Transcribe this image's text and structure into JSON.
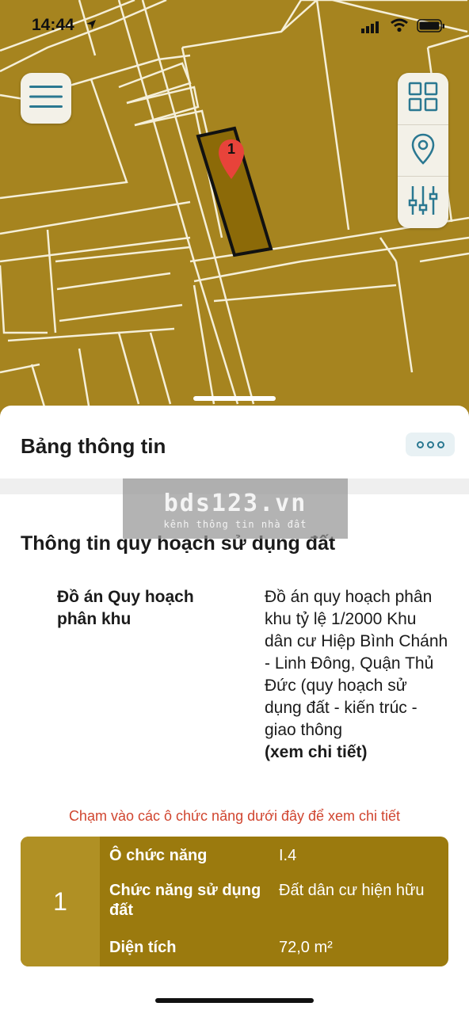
{
  "status_bar": {
    "time": "14:44"
  },
  "map": {
    "fill_color": "#a6841f",
    "line_color": "#f5efd8",
    "marker_label": "1",
    "marker_color": "#e8433a"
  },
  "toolbar": {
    "menu_icon": "hamburger-icon",
    "tools": [
      {
        "icon": "grid-icon"
      },
      {
        "icon": "location-pin-icon"
      },
      {
        "icon": "sliders-icon"
      }
    ]
  },
  "sheet": {
    "title": "Bảng thông tin",
    "more_icon": "more-dots-icon"
  },
  "watermark": {
    "main": "bds123.vn",
    "sub": "kênh thông tin nhà đất"
  },
  "planning": {
    "section_title": "Thông tin quy hoạch sử dụng đất",
    "label": "Đồ án Quy hoạch phân khu",
    "value": "Đồ án quy hoạch phân khu tỷ lệ 1/2000 Khu dân cư Hiệp Bình Chánh - Linh Đông, Quận Thủ Đức (quy hoạch sử dụng đất - kiến trúc - giao thông",
    "link_text": "(xem chi tiết)"
  },
  "hint": "Chạm vào các ô chức năng dưới đây để xem chi tiết",
  "zone": {
    "index": "1",
    "rows": [
      {
        "key": "Ô chức năng",
        "value": "I.4"
      },
      {
        "key": "Chức năng sử dụng đất",
        "value": "Đất dân cư hiện hữu"
      },
      {
        "key": "Diện tích",
        "value": "72,0 m²"
      }
    ],
    "card_color": "#9b7a0e",
    "index_color": "#b09024"
  }
}
